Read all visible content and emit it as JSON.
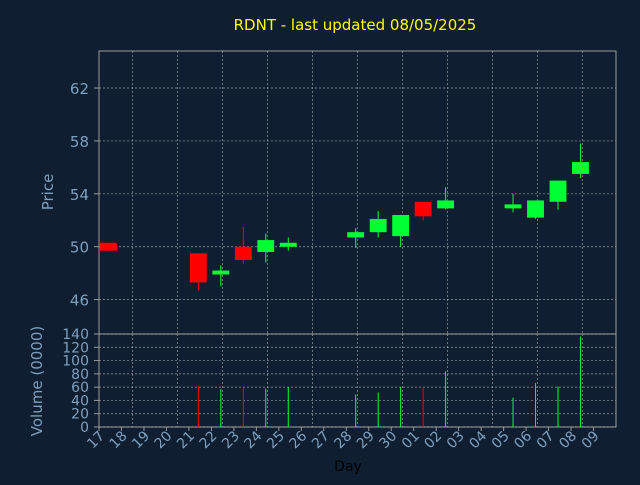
{
  "chart_data": {
    "type": "candlestick",
    "title": "RDNT - last updated 08/05/2025",
    "xlabel": "Day",
    "ylabel_price": "Price",
    "ylabel_volume": "Volume (0000)",
    "price_ticks": [
      46,
      50,
      54,
      58,
      62
    ],
    "price_ylim": [
      43.4,
      64.8
    ],
    "volume_ticks": [
      0,
      20,
      40,
      60,
      80,
      100,
      120,
      140
    ],
    "volume_ylim": [
      0,
      140
    ],
    "grid": true,
    "x_tick_labels": [
      "17",
      "18",
      "19",
      "20",
      "21",
      "22",
      "23",
      "24",
      "25",
      "26",
      "27",
      "28",
      "29",
      "30",
      "01",
      "02",
      "03",
      "04",
      "05",
      "06",
      "07",
      "08",
      "09"
    ],
    "candles": [
      {
        "day": "17",
        "open": 50.3,
        "high": 50.3,
        "low": 49.7,
        "close": 49.7,
        "volume": 0
      },
      {
        "day": "21",
        "open": 49.5,
        "high": 49.5,
        "low": 46.7,
        "close": 47.3,
        "volume": 62
      },
      {
        "day": "22",
        "open": 47.9,
        "high": 48.6,
        "low": 47.0,
        "close": 48.2,
        "volume": 57
      },
      {
        "day": "23",
        "open": 50.0,
        "high": 51.5,
        "low": 48.7,
        "close": 49.0,
        "volume": 60
      },
      {
        "day": "24",
        "open": 49.6,
        "high": 51.0,
        "low": 48.8,
        "close": 50.5,
        "volume": 58
      },
      {
        "day": "25",
        "open": 50.0,
        "high": 50.7,
        "low": 49.7,
        "close": 50.3,
        "volume": 60
      },
      {
        "day": "28",
        "open": 50.7,
        "high": 51.4,
        "low": 49.9,
        "close": 51.1,
        "volume": 49
      },
      {
        "day": "29",
        "open": 51.1,
        "high": 52.7,
        "low": 50.7,
        "close": 52.1,
        "volume": 52
      },
      {
        "day": "30",
        "open": 50.8,
        "high": 52.4,
        "low": 50.0,
        "close": 52.4,
        "volume": 60
      },
      {
        "day": "01",
        "open": 53.4,
        "high": 53.4,
        "low": 52.0,
        "close": 52.3,
        "volume": 60
      },
      {
        "day": "02",
        "open": 52.9,
        "high": 54.5,
        "low": 52.8,
        "close": 53.5,
        "volume": 84
      },
      {
        "day": "05",
        "open": 52.9,
        "high": 54.0,
        "low": 52.6,
        "close": 53.2,
        "volume": 44
      },
      {
        "day": "06",
        "open": 52.2,
        "high": 53.5,
        "low": 52.1,
        "close": 53.5,
        "volume": 66
      },
      {
        "day": "07",
        "open": 53.4,
        "high": 55.0,
        "low": 52.8,
        "close": 55.0,
        "volume": 61
      },
      {
        "day": "08",
        "open": 55.5,
        "high": 57.8,
        "low": 55.2,
        "close": 56.4,
        "volume": 136
      }
    ],
    "colors": {
      "background": "#0f1e30",
      "up": "#00ff33",
      "down": "#ff0000",
      "text": "#7f9fbf",
      "title": "#ffff00",
      "grid": "#bbbbbb",
      "axis": "#9a9a9a"
    }
  }
}
